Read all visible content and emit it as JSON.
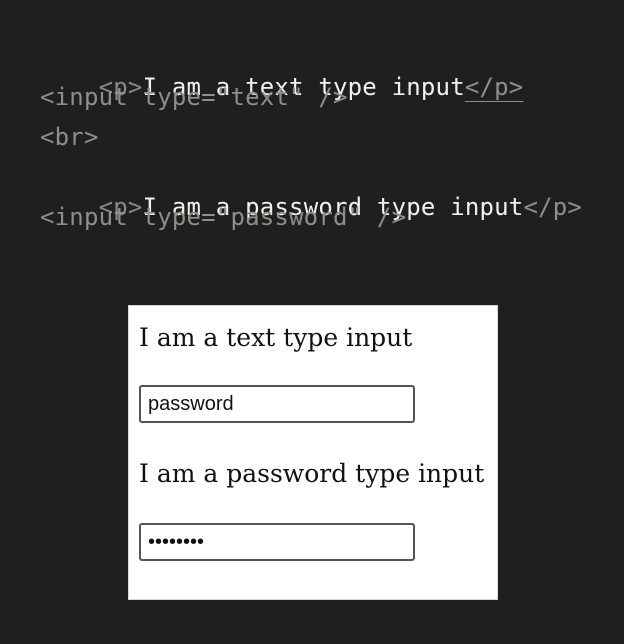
{
  "code_snippet": {
    "lines": [
      {
        "open": "<p>",
        "text": "I am a text type input",
        "close": "</p>"
      },
      {
        "code": "<input type=\"text\" />"
      },
      {
        "code": "<br>"
      },
      {
        "open": "<p>",
        "text": "I am a password type input",
        "close": "</p>"
      },
      {
        "code": "<input type=\"password\" />"
      }
    ]
  },
  "preview": {
    "text_input_label": "I am a text type input",
    "text_input_value": "password",
    "password_input_label": "I am a password type input",
    "password_input_value": "password"
  },
  "colors": {
    "background": "#1f1f21",
    "code_text": "#f1f1ec",
    "code_syntax": "#8f8f86",
    "preview_background": "#ffffff",
    "input_border": "#555555"
  }
}
